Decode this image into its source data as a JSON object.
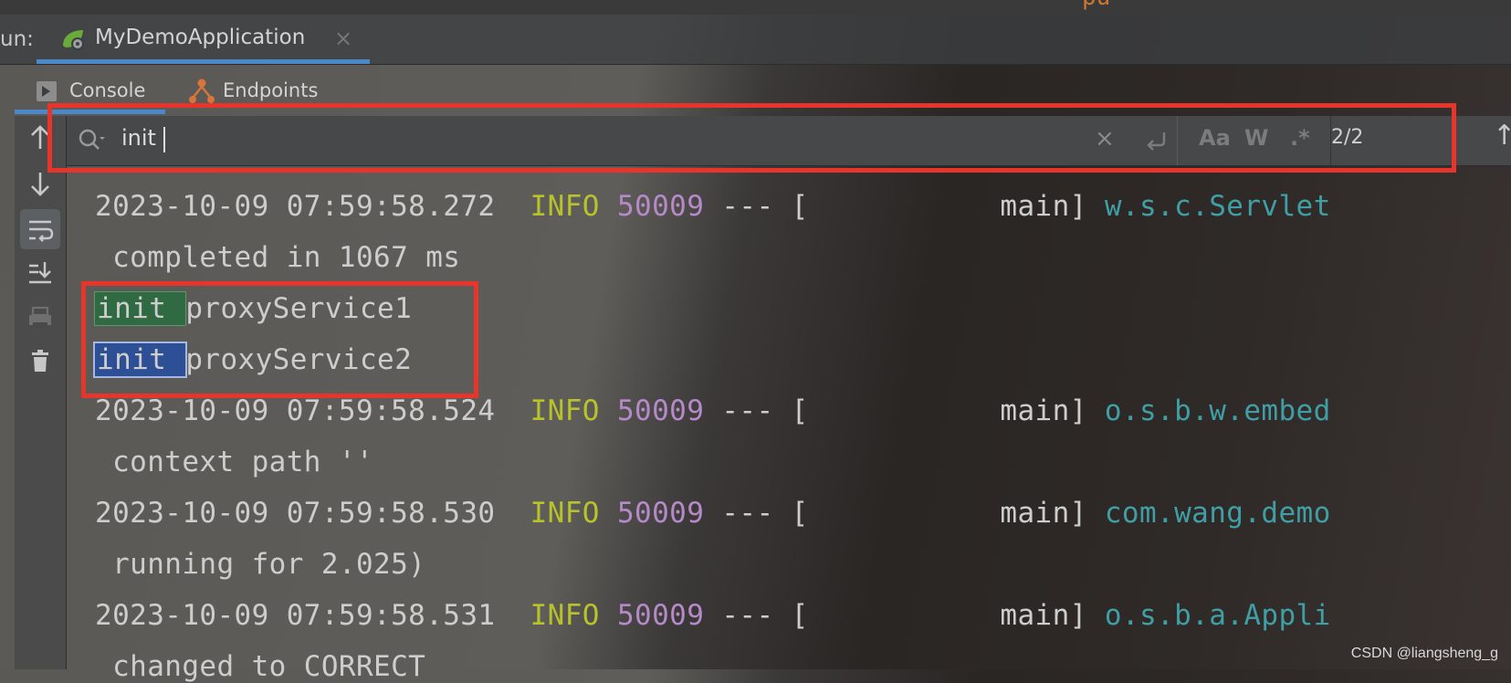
{
  "run_panel": {
    "label": "un:",
    "config_name": "MyDemoApplication",
    "close_glyph": "×"
  },
  "tabs": {
    "console": "Console",
    "endpoints": "Endpoints"
  },
  "search": {
    "query": "init",
    "match_count": "2/2",
    "clear_glyph": "×",
    "match_case_label": "Aa",
    "words_label": "W",
    "regex_label": ".*"
  },
  "console_lines": [
    {
      "type": "log",
      "timestamp": "2023-10-09 07:59:58.272",
      "level": "INFO",
      "pid": "50009",
      "sep": "---",
      "thread": "[           main]",
      "logger": "w.s.c.Servlet"
    },
    {
      "type": "text",
      "text": " completed in 1067 ms"
    },
    {
      "type": "match",
      "match": "init ",
      "rest": "proxyService1",
      "current": false
    },
    {
      "type": "match",
      "match": "init ",
      "rest": "proxyService2",
      "current": true
    },
    {
      "type": "log",
      "timestamp": "2023-10-09 07:59:58.524",
      "level": "INFO",
      "pid": "50009",
      "sep": "---",
      "thread": "[           main]",
      "logger": "o.s.b.w.embed"
    },
    {
      "type": "text",
      "text": " context path ''"
    },
    {
      "type": "log",
      "timestamp": "2023-10-09 07:59:58.530",
      "level": "INFO",
      "pid": "50009",
      "sep": "---",
      "thread": "[           main]",
      "logger": "com.wang.demo"
    },
    {
      "type": "text",
      "text": " running for 2.025)"
    },
    {
      "type": "log",
      "timestamp": "2023-10-09 07:59:58.531",
      "level": "INFO",
      "pid": "50009",
      "sep": "---",
      "thread": "[           main]",
      "logger": "o.s.b.a.Appli"
    },
    {
      "type": "text",
      "text": " changed to CORRECT"
    }
  ],
  "watermark": "CSDN @liangsheng_g",
  "colors": {
    "accent": "#4a88c7",
    "annotation_red": "#e8352c",
    "log_info": "#b8c22c",
    "log_pid": "#b689c9",
    "log_logger": "#3f9fa5",
    "match_highlight": "#2f6a42",
    "current_match_highlight": "#2c4f95"
  }
}
